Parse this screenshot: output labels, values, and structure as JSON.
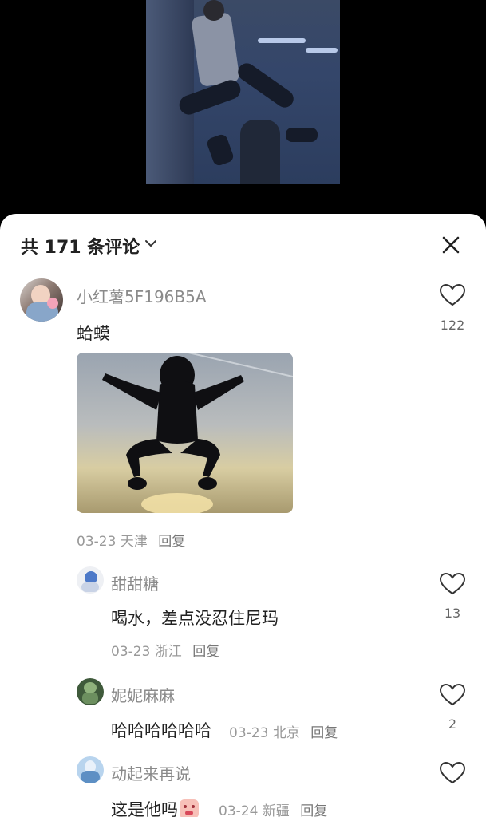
{
  "header": {
    "comment_count_title": "共 171 条评论"
  },
  "icons": {
    "caret": "chevron-down-icon",
    "close": "close-icon",
    "like": "heart-icon"
  },
  "comments": [
    {
      "username": "小红薯5F196B5A",
      "text": "蛤蟆",
      "date": "03-23",
      "location": "天津",
      "reply_label": "回复",
      "likes": "122",
      "has_image": true
    },
    {
      "username": "甜甜糖",
      "text": "喝水，差点没忍住尼玛",
      "date": "03-23",
      "location": "浙江",
      "reply_label": "回复",
      "likes": "13"
    },
    {
      "username": "妮妮麻麻",
      "text": "哈哈哈哈哈哈",
      "date": "03-23",
      "location": "北京",
      "reply_label": "回复",
      "likes": "2"
    },
    {
      "username": "动起来再说",
      "text": "这是他吗",
      "date": "03-24",
      "location": "新疆",
      "reply_label": "回复",
      "likes": ""
    }
  ]
}
